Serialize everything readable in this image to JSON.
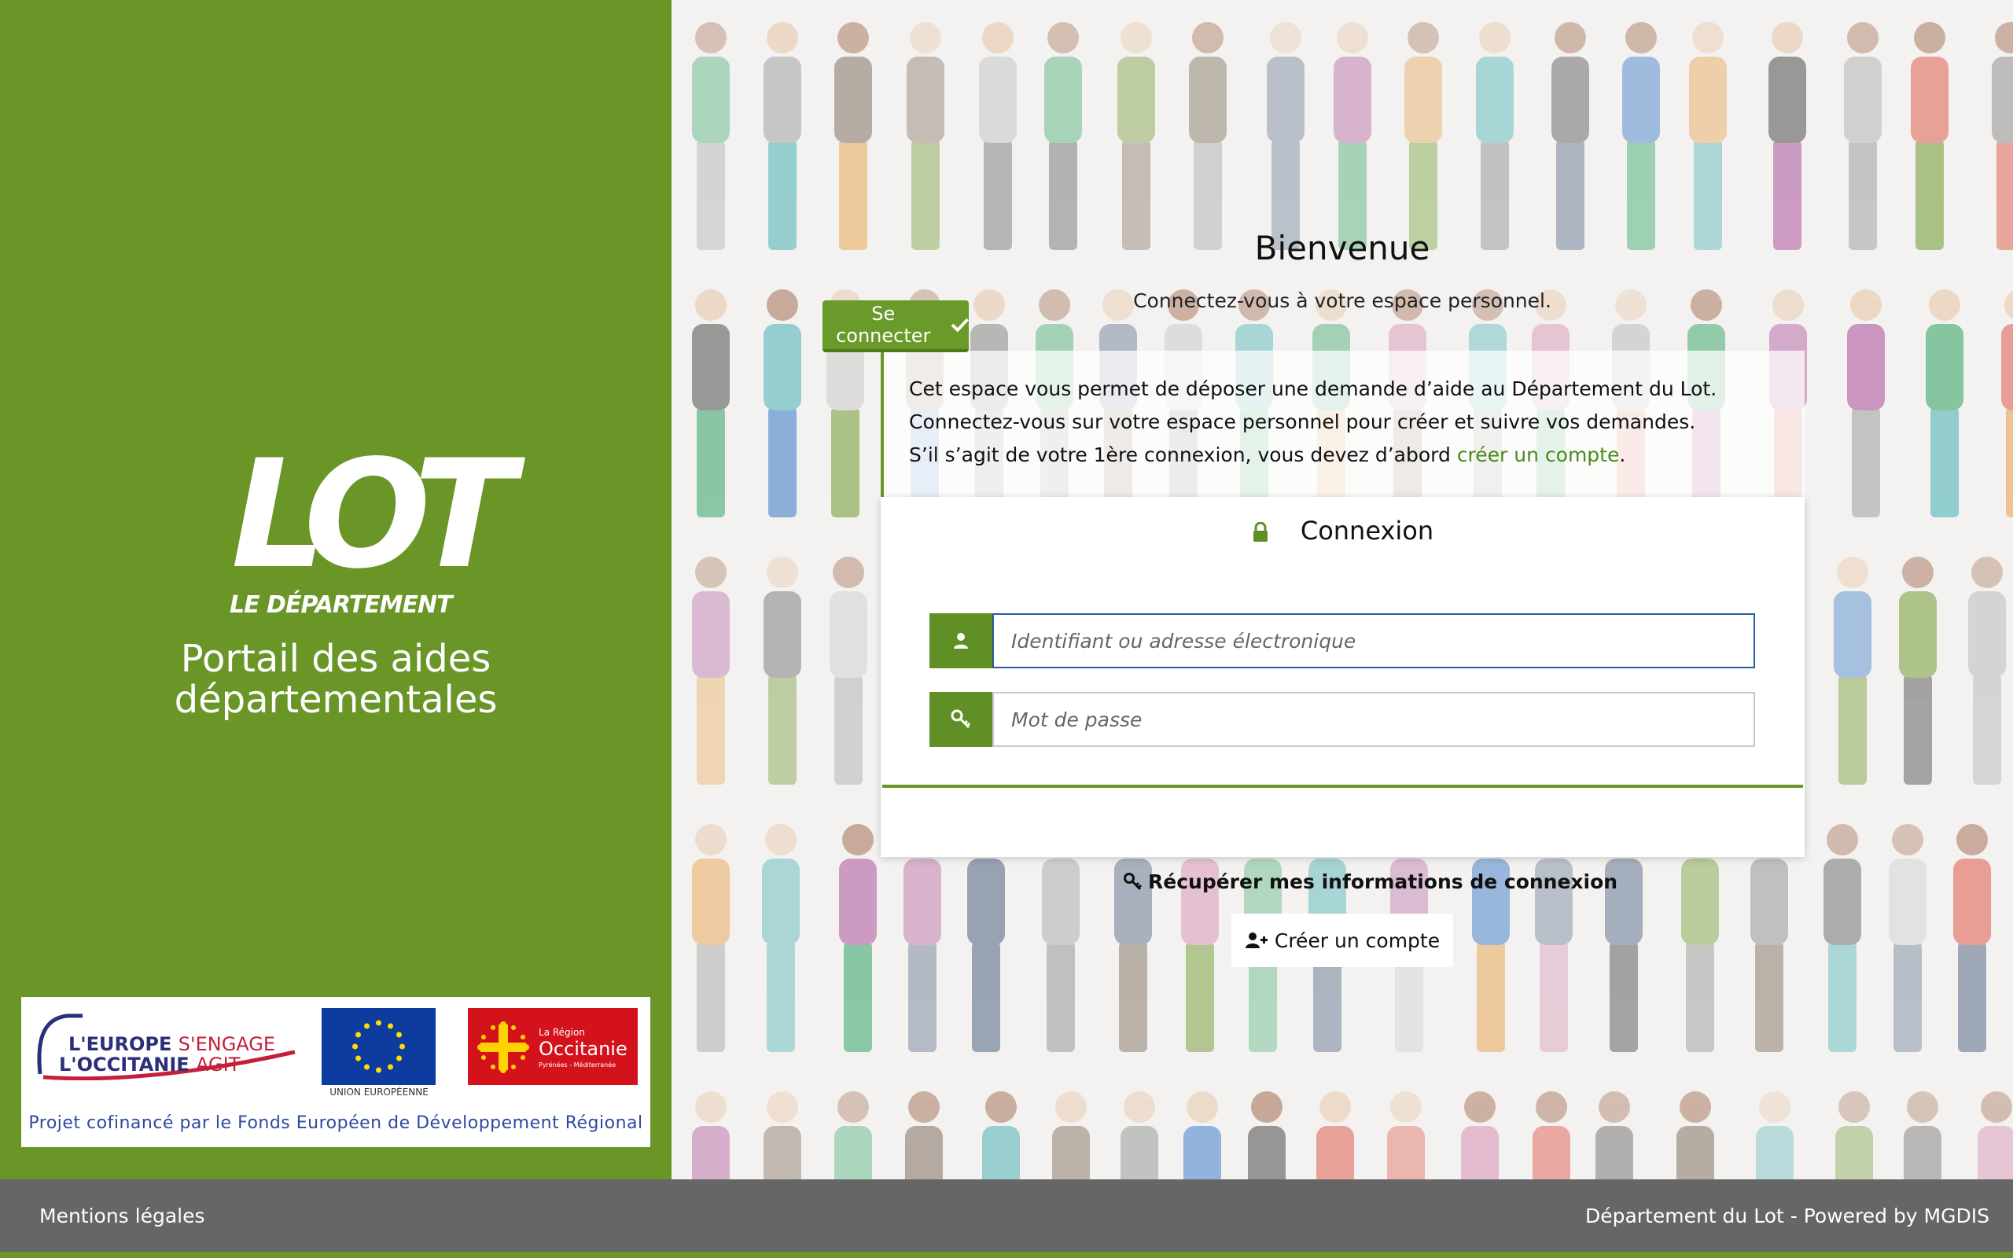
{
  "branding": {
    "logo_text": "LOT",
    "logo_subtext": "LE DÉPARTEMENT",
    "portal_title_line1": "Portail des aides",
    "portal_title_line2": "départementales"
  },
  "partners": {
    "europe_line1_strong": "L'EUROPE",
    "europe_line1_light": "S'ENGAGE",
    "europe_line2_strong": "L'OCCITANIE",
    "europe_line2_light": "AGIT",
    "eu_caption": "UNION EUROPÉENNE",
    "region_small": "La Région",
    "region_name": "Occitanie",
    "region_tiny": "Pyrénées - Méditerranée",
    "caption": "Projet cofinancé par le Fonds Européen de Développement Régional"
  },
  "welcome": {
    "title": "Bienvenue",
    "subtitle": "Connectez-vous à votre espace personnel."
  },
  "info": {
    "line1": "Cet espace vous permet de déposer une demande d’aide au Département du Lot.",
    "line2": "Connectez-vous sur votre espace personnel pour créer et suivre vos demandes.",
    "line3_prefix": "S’il s’agit de votre 1ère connexion, vous devez d’abord ",
    "line3_link": "créer un compte",
    "line3_suffix": "."
  },
  "login": {
    "title": "Connexion",
    "username_placeholder": "Identifiant ou adresse électronique",
    "password_placeholder": "Mot de passe",
    "submit_label": "Se connecter",
    "recover_label": "Récupérer mes informations de connexion",
    "create_account_label": "Créer un compte"
  },
  "footer": {
    "left": "Mentions légales",
    "right": "Département du Lot - Powered by MGDIS"
  },
  "colors": {
    "brand_green": "#6a9527",
    "footer_gray": "#666666",
    "link_green": "#4a8a1c"
  },
  "icons": {
    "lock": "lock-icon",
    "user": "user-icon",
    "key": "key-icon",
    "check": "check-icon",
    "add_user": "add-user-icon"
  }
}
